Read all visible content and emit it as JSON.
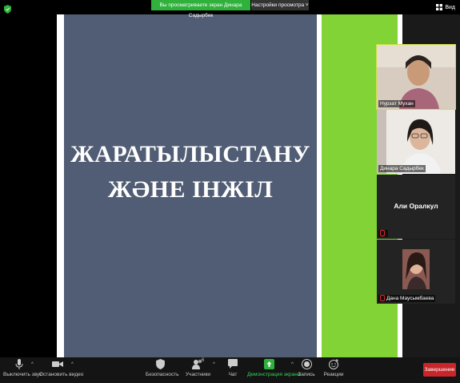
{
  "banner": {
    "sharing_text": "Вы просматриваете экран Динара Садырбек",
    "view_options": "Настройки просмотра",
    "view_button": "Вид"
  },
  "slide": {
    "title_line1": "ЖАРАТЫЛЫСТАНУ",
    "title_line2": "ЖӘНЕ ІНЖІЛ"
  },
  "participants": [
    {
      "name": "Нурзат Мухан"
    },
    {
      "name": "Динара Садырбек"
    },
    {
      "name": "Али Оралкул"
    },
    {
      "name": "Дана Маусымбаева"
    }
  ],
  "toolbar": {
    "mute": "Выключить звук",
    "video": "Остановить видео",
    "security": "Безопасность",
    "participants": "Участники",
    "participants_count": "6",
    "chat": "Чат",
    "share": "Демонстрация экрана",
    "record": "Запись",
    "reactions": "Реакции",
    "end": "Завершение"
  },
  "colors": {
    "share_banner": "#2fb13b",
    "slide_panel": "#515d74",
    "slide_green": "#82d336",
    "end_button": "#c8262a",
    "active_speaker": "#c9e23c"
  }
}
